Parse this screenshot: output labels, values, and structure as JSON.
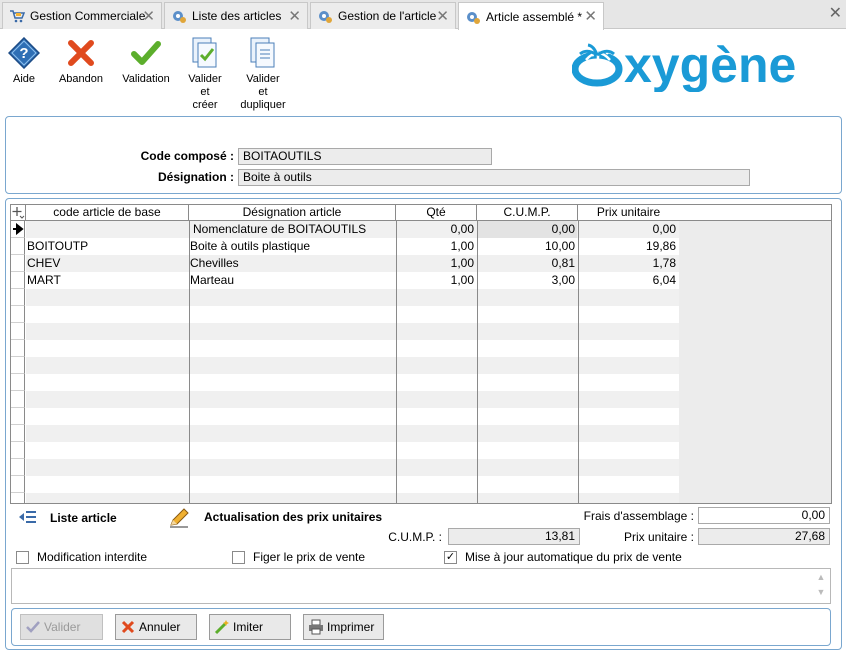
{
  "tabs": [
    {
      "label": "Gestion Commerciale",
      "icon": "cart-icon"
    },
    {
      "label": "Liste des articles",
      "icon": "gear-icon"
    },
    {
      "label": "Gestion de l'article",
      "icon": "gear-icon"
    },
    {
      "label": "Article assemblé *",
      "icon": "gear-icon",
      "active": true
    }
  ],
  "toolbar": {
    "aide": "Aide",
    "abandon": "Abandon",
    "validation": "Validation",
    "valider_creer": [
      "Valider",
      "et",
      "créer"
    ],
    "valider_dupliquer": [
      "Valider",
      "et",
      "dupliquer"
    ]
  },
  "logo": {
    "text": "xygène",
    "color": "#1a9ad6"
  },
  "header": {
    "code_label": "Code composé :",
    "code_value": "BOITAOUTILS",
    "designation_label": "Désignation :",
    "designation_value": "Boite à outils"
  },
  "grid": {
    "headers": [
      "code article de base",
      "Désignation article",
      "Qté",
      "C.U.M.P.",
      "Prix unitaire"
    ],
    "rows": [
      {
        "code": "",
        "designation": "Nomenclature de BOITAOUTILS",
        "qte": "0,00",
        "cump": "0,00",
        "prix": "0,00",
        "current": true
      },
      {
        "code": "BOITOUTP",
        "designation": "Boite à outils plastique",
        "qte": "1,00",
        "cump": "10,00",
        "prix": "19,86"
      },
      {
        "code": "CHEV",
        "designation": "Chevilles",
        "qte": "1,00",
        "cump": "0,81",
        "prix": "1,78"
      },
      {
        "code": "MART",
        "designation": "Marteau",
        "qte": "1,00",
        "cump": "3,00",
        "prix": "6,04"
      }
    ]
  },
  "bottom": {
    "liste_article": "Liste article",
    "actualisation": "Actualisation des prix unitaires",
    "frais_label": "Frais d'assemblage :",
    "frais_value": "0,00",
    "cump_label": "C.U.M.P. :",
    "cump_value": "13,81",
    "prix_label": "Prix unitaire :",
    "prix_value": "27,68",
    "chk_modif": "Modification interdite",
    "chk_figer": "Figer le prix de vente",
    "chk_maj": "Mise à jour automatique du prix de vente"
  },
  "buttons": {
    "valider": "Valider",
    "annuler": "Annuler",
    "imiter": "Imiter",
    "imprimer": "Imprimer"
  },
  "colors": {
    "accent_border": "#7aa7cf",
    "logo_blue": "#1a9ad6",
    "grid_fill": "#ececec"
  }
}
